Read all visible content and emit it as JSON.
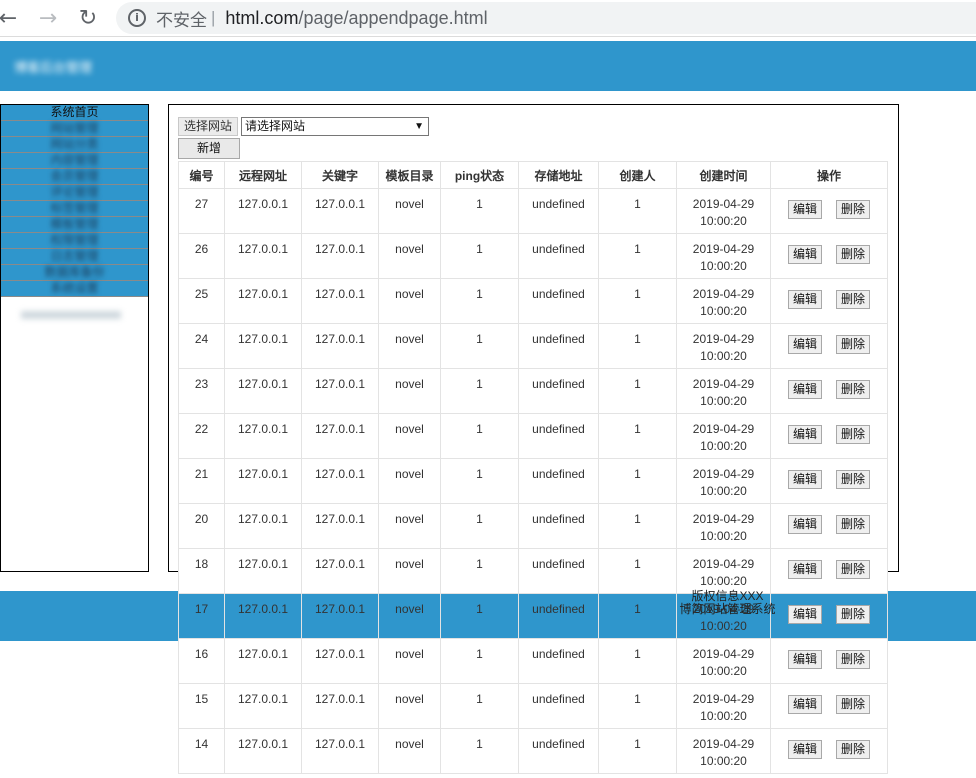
{
  "browser": {
    "security_label": "不安全",
    "separator": "|",
    "host": "html.com",
    "path": "/page/appendpage.html",
    "back_glyph": "←",
    "forward_glyph": "→",
    "reload_glyph": "↻",
    "info_glyph": "i"
  },
  "header": {
    "brand": "博客后台管理"
  },
  "sidebar": {
    "items": [
      {
        "label": "系统首页",
        "blurred": false
      },
      {
        "label": "网站管理",
        "blurred": true
      },
      {
        "label": "网站分类",
        "blurred": true
      },
      {
        "label": "内容管理",
        "blurred": true
      },
      {
        "label": "会员管理",
        "blurred": true
      },
      {
        "label": "评论管理",
        "blurred": true
      },
      {
        "label": "标签管理",
        "blurred": true
      },
      {
        "label": "模板管理",
        "blurred": true
      },
      {
        "label": "权限管理",
        "blurred": true
      },
      {
        "label": "日志管理",
        "blurred": true
      },
      {
        "label": "数据库备份",
        "blurred": true
      },
      {
        "label": "系统设置",
        "blurred": true
      }
    ]
  },
  "toolbar": {
    "site_label": "选择网站",
    "site_select_value": "请选择网站",
    "add_button": "新增"
  },
  "table": {
    "columns": [
      "编号",
      "远程网址",
      "关键字",
      "模板目录",
      "ping状态",
      "存储地址",
      "创建人",
      "创建时间",
      "操作"
    ],
    "edit_label": "编辑",
    "delete_label": "删除",
    "rows": [
      {
        "id": "27",
        "url": "127.0.0.1",
        "keyword": "127.0.0.1",
        "template": "novel",
        "ping": "1",
        "storage": "undefined",
        "creator": "1",
        "date": "2019-04-29",
        "time": "10:00:20"
      },
      {
        "id": "26",
        "url": "127.0.0.1",
        "keyword": "127.0.0.1",
        "template": "novel",
        "ping": "1",
        "storage": "undefined",
        "creator": "1",
        "date": "2019-04-29",
        "time": "10:00:20"
      },
      {
        "id": "25",
        "url": "127.0.0.1",
        "keyword": "127.0.0.1",
        "template": "novel",
        "ping": "1",
        "storage": "undefined",
        "creator": "1",
        "date": "2019-04-29",
        "time": "10:00:20"
      },
      {
        "id": "24",
        "url": "127.0.0.1",
        "keyword": "127.0.0.1",
        "template": "novel",
        "ping": "1",
        "storage": "undefined",
        "creator": "1",
        "date": "2019-04-29",
        "time": "10:00:20"
      },
      {
        "id": "23",
        "url": "127.0.0.1",
        "keyword": "127.0.0.1",
        "template": "novel",
        "ping": "1",
        "storage": "undefined",
        "creator": "1",
        "date": "2019-04-29",
        "time": "10:00:20"
      },
      {
        "id": "22",
        "url": "127.0.0.1",
        "keyword": "127.0.0.1",
        "template": "novel",
        "ping": "1",
        "storage": "undefined",
        "creator": "1",
        "date": "2019-04-29",
        "time": "10:00:20"
      },
      {
        "id": "21",
        "url": "127.0.0.1",
        "keyword": "127.0.0.1",
        "template": "novel",
        "ping": "1",
        "storage": "undefined",
        "creator": "1",
        "date": "2019-04-29",
        "time": "10:00:20"
      },
      {
        "id": "20",
        "url": "127.0.0.1",
        "keyword": "127.0.0.1",
        "template": "novel",
        "ping": "1",
        "storage": "undefined",
        "creator": "1",
        "date": "2019-04-29",
        "time": "10:00:20"
      },
      {
        "id": "18",
        "url": "127.0.0.1",
        "keyword": "127.0.0.1",
        "template": "novel",
        "ping": "1",
        "storage": "undefined",
        "creator": "1",
        "date": "2019-04-29",
        "time": "10:00:20"
      },
      {
        "id": "17",
        "url": "127.0.0.1",
        "keyword": "127.0.0.1",
        "template": "novel",
        "ping": "1",
        "storage": "undefined",
        "creator": "1",
        "date": "2019-04-29",
        "time": "10:00:20"
      },
      {
        "id": "16",
        "url": "127.0.0.1",
        "keyword": "127.0.0.1",
        "template": "novel",
        "ping": "1",
        "storage": "undefined",
        "creator": "1",
        "date": "2019-04-29",
        "time": "10:00:20"
      },
      {
        "id": "15",
        "url": "127.0.0.1",
        "keyword": "127.0.0.1",
        "template": "novel",
        "ping": "1",
        "storage": "undefined",
        "creator": "1",
        "date": "2019-04-29",
        "time": "10:00:20"
      },
      {
        "id": "14",
        "url": "127.0.0.1",
        "keyword": "127.0.0.1",
        "template": "novel",
        "ping": "1",
        "storage": "undefined",
        "creator": "1",
        "date": "2019-04-29",
        "time": "10:00:20"
      }
    ]
  },
  "footer": {
    "line1": "版权信息XXX",
    "line2": "博简网站管理系统"
  },
  "colors": {
    "accent": "#2f96cc"
  }
}
